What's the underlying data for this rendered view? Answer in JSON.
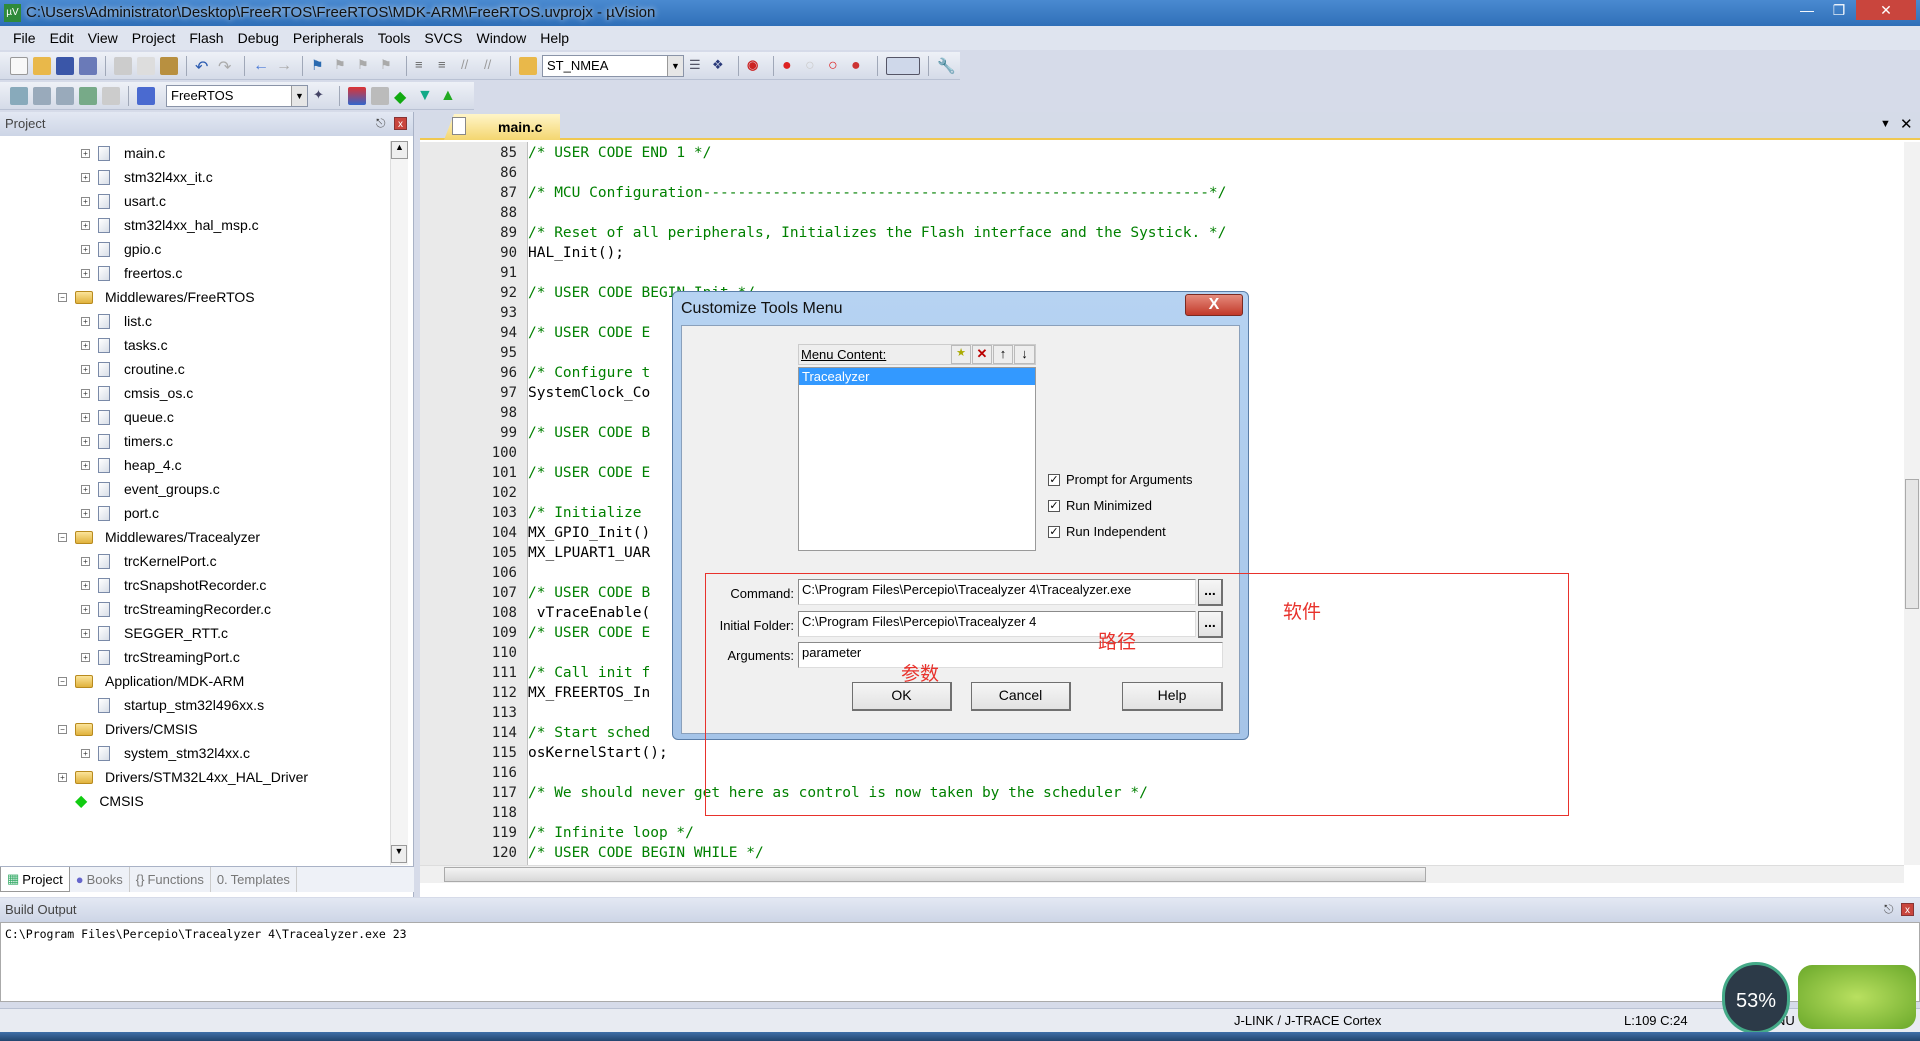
{
  "window": {
    "title": "C:\\Users\\Administrator\\Desktop\\FreeRTOS\\FreeRTOS\\MDK-ARM\\FreeRTOS.uvprojx - µVision",
    "app_icon": "uvision-icon"
  },
  "menu": [
    "File",
    "Edit",
    "View",
    "Project",
    "Flash",
    "Debug",
    "Peripherals",
    "Tools",
    "SVCS",
    "Window",
    "Help"
  ],
  "toolbar1": {
    "combo": "ST_NMEA"
  },
  "toolbar2": {
    "combo": "FreeRTOS"
  },
  "project": {
    "header": "Project",
    "tree": [
      {
        "label": "main.c",
        "type": "file",
        "level": 2
      },
      {
        "label": "stm32l4xx_it.c",
        "type": "file",
        "level": 2
      },
      {
        "label": "usart.c",
        "type": "file",
        "level": 2
      },
      {
        "label": "stm32l4xx_hal_msp.c",
        "type": "file",
        "level": 2
      },
      {
        "label": "gpio.c",
        "type": "file",
        "level": 2
      },
      {
        "label": "freertos.c",
        "type": "file",
        "level": 2
      },
      {
        "label": "Middlewares/FreeRTOS",
        "type": "folder",
        "level": 1
      },
      {
        "label": "list.c",
        "type": "file",
        "level": 2
      },
      {
        "label": "tasks.c",
        "type": "file",
        "level": 2
      },
      {
        "label": "croutine.c",
        "type": "file",
        "level": 2
      },
      {
        "label": "cmsis_os.c",
        "type": "file",
        "level": 2
      },
      {
        "label": "queue.c",
        "type": "file",
        "level": 2
      },
      {
        "label": "timers.c",
        "type": "file",
        "level": 2
      },
      {
        "label": "heap_4.c",
        "type": "file",
        "level": 2
      },
      {
        "label": "event_groups.c",
        "type": "file",
        "level": 2
      },
      {
        "label": "port.c",
        "type": "file",
        "level": 2
      },
      {
        "label": "Middlewares/Tracealyzer",
        "type": "folder",
        "level": 1
      },
      {
        "label": "trcKernelPort.c",
        "type": "file",
        "level": 2
      },
      {
        "label": "trcSnapshotRecorder.c",
        "type": "file",
        "level": 2
      },
      {
        "label": "trcStreamingRecorder.c",
        "type": "file",
        "level": 2
      },
      {
        "label": "SEGGER_RTT.c",
        "type": "file",
        "level": 2
      },
      {
        "label": "trcStreamingPort.c",
        "type": "file",
        "level": 2
      },
      {
        "label": "Application/MDK-ARM",
        "type": "folder",
        "level": 1
      },
      {
        "label": "startup_stm32l496xx.s",
        "type": "file",
        "level": 2
      },
      {
        "label": "Drivers/CMSIS",
        "type": "folder",
        "level": 1
      },
      {
        "label": "system_stm32l4xx.c",
        "type": "file",
        "level": 2
      },
      {
        "label": "Drivers/STM32L4xx_HAL_Driver",
        "type": "folder-closed",
        "level": 1
      },
      {
        "label": "CMSIS",
        "type": "component",
        "level": 1
      }
    ],
    "tabs": [
      "Project",
      "Books",
      "Functions",
      "Templates"
    ]
  },
  "editor": {
    "tab": "main.c",
    "lines": [
      {
        "n": "85",
        "t": "/* USER CODE END 1 */",
        "c": true
      },
      {
        "n": "86",
        "t": "",
        "c": false
      },
      {
        "n": "87",
        "t": "/* MCU Configuration----------------------------------------------------------*/",
        "c": true
      },
      {
        "n": "88",
        "t": "",
        "c": false
      },
      {
        "n": "89",
        "t": "/* Reset of all peripherals, Initializes the Flash interface and the Systick. */",
        "c": true
      },
      {
        "n": "90",
        "t": "HAL_Init();",
        "c": false
      },
      {
        "n": "91",
        "t": "",
        "c": false
      },
      {
        "n": "92",
        "t": "/* USER CODE BEGIN Init */",
        "c": true
      },
      {
        "n": "93",
        "t": "",
        "c": false
      },
      {
        "n": "94",
        "t": "/* USER CODE E",
        "c": true
      },
      {
        "n": "95",
        "t": "",
        "c": false
      },
      {
        "n": "96",
        "t": "/* Configure t",
        "c": true
      },
      {
        "n": "97",
        "t": "SystemClock_Co",
        "c": false
      },
      {
        "n": "98",
        "t": "",
        "c": false
      },
      {
        "n": "99",
        "t": "/* USER CODE B",
        "c": true
      },
      {
        "n": "100",
        "t": "",
        "c": false
      },
      {
        "n": "101",
        "t": "/* USER CODE E",
        "c": true
      },
      {
        "n": "102",
        "t": "",
        "c": false
      },
      {
        "n": "103",
        "t": "/* Initialize",
        "c": true
      },
      {
        "n": "104",
        "t": "MX_GPIO_Init()",
        "c": false
      },
      {
        "n": "105",
        "t": "MX_LPUART1_UAR",
        "c": false
      },
      {
        "n": "106",
        "t": "",
        "c": false
      },
      {
        "n": "107",
        "t": "/* USER CODE B",
        "c": true
      },
      {
        "n": "108",
        "t": " vTraceEnable(",
        "c": false
      },
      {
        "n": "109",
        "t": "/* USER CODE E",
        "c": true
      },
      {
        "n": "110",
        "t": "",
        "c": false
      },
      {
        "n": "111",
        "t": "/* Call init f",
        "c": true
      },
      {
        "n": "112",
        "t": "MX_FREERTOS_In",
        "c": false
      },
      {
        "n": "113",
        "t": "",
        "c": false
      },
      {
        "n": "114",
        "t": "/* Start sched",
        "c": true
      },
      {
        "n": "115",
        "t": "osKernelStart();",
        "c": false
      },
      {
        "n": "116",
        "t": "",
        "c": false
      },
      {
        "n": "117",
        "t": "/* We should never get here as control is now taken by the scheduler */",
        "c": true
      },
      {
        "n": "118",
        "t": "",
        "c": false
      },
      {
        "n": "119",
        "t": "/* Infinite loop */",
        "c": true
      },
      {
        "n": "120",
        "t": "/* USER CODE BEGIN WHILE */",
        "c": true
      }
    ]
  },
  "build": {
    "header": "Build Output",
    "text": "C:\\Program Files\\Percepio\\Tracealyzer 4\\Tracealyzer.exe 23"
  },
  "status": {
    "debugger": "J-LINK / J-TRACE Cortex",
    "position": "L:109 C:24",
    "cap": "NU"
  },
  "dialog": {
    "title": "Customize Tools Menu",
    "menu_content_label": "Menu Content:",
    "items": [
      "Tracealyzer"
    ],
    "checks": [
      {
        "label": "Prompt for Arguments",
        "checked": true
      },
      {
        "label": "Run Minimized",
        "checked": true
      },
      {
        "label": "Run Independent",
        "checked": true
      }
    ],
    "command_label": "Command:",
    "command": "C:\\Program Files\\Percepio\\Tracealyzer 4\\Tracealyzer.exe",
    "folder_label": "Initial Folder:",
    "folder": "C:\\Program Files\\Percepio\\Tracealyzer 4",
    "args_label": "Arguments:",
    "args": "parameter",
    "browse": "...",
    "ok": "OK",
    "cancel": "Cancel",
    "help": "Help"
  },
  "annotations": {
    "software": "软件",
    "path": "路径",
    "params": "参数",
    "color": "#e8322c"
  },
  "overlay": {
    "cpu": "53%"
  }
}
